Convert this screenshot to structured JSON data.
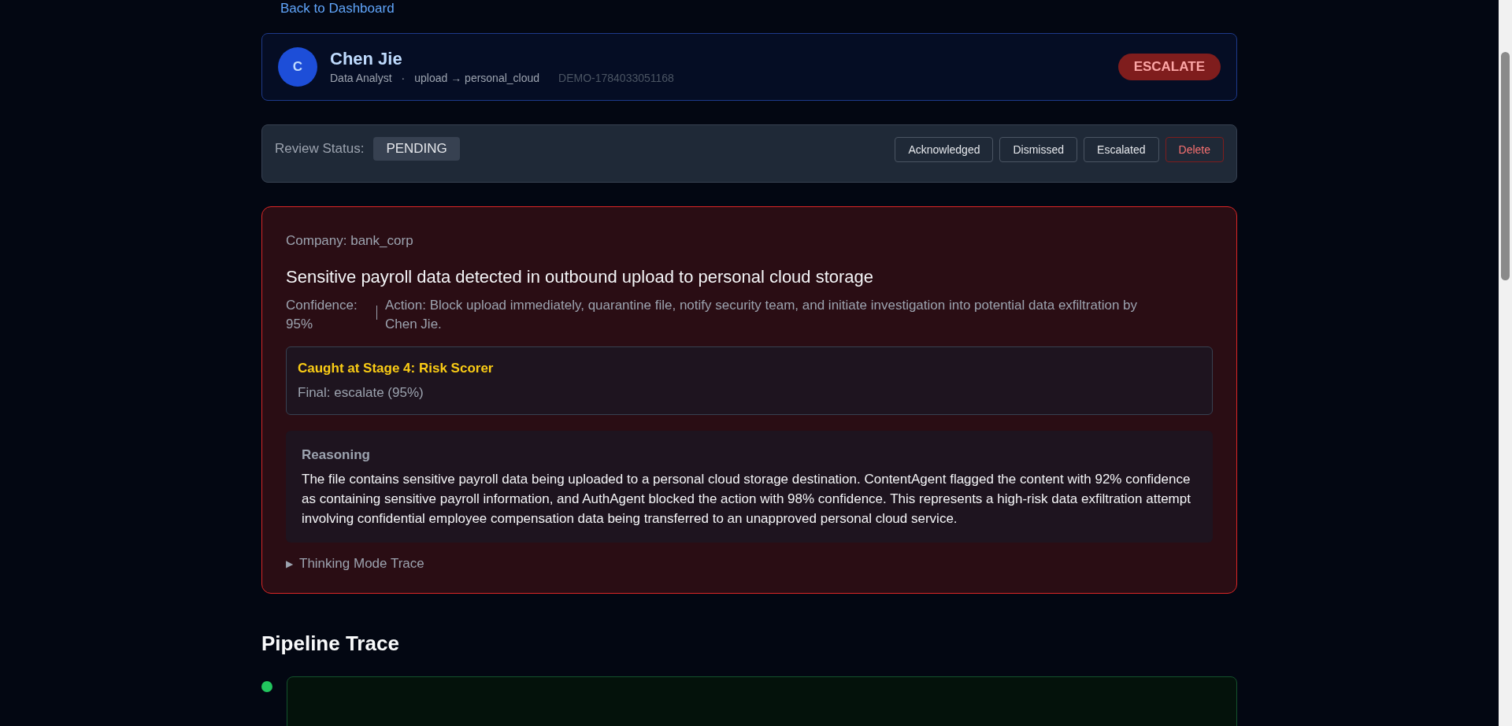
{
  "back_link": "Back to Dashboard",
  "header": {
    "avatar": "C",
    "name": "Chen Jie",
    "role": "Data Analyst",
    "separator": "·",
    "action": "upload → personal_cloud",
    "id": "DEMO-1784033051168",
    "verdict": {
      "label": "ESCALATE",
      "kind": "escalate"
    }
  },
  "review": {
    "label": "Review Status:",
    "status": "PENDING",
    "buttons": [
      {
        "label": "Acknowledged",
        "kind": "normal"
      },
      {
        "label": "Dismissed",
        "kind": "normal"
      },
      {
        "label": "Escalated",
        "kind": "normal"
      },
      {
        "label": "Delete",
        "kind": "danger"
      }
    ]
  },
  "alert": {
    "kind": "high",
    "company": "Company: bank_corp",
    "title": "Sensitive payroll data detected in outbound upload to personal cloud storage",
    "confidence": "Confidence: 95%",
    "action": "Action: Block upload immediately, quarantine file, notify security team, and initiate investigation into potential data exfiltration by Chen Jie.",
    "caught": {
      "title": "Caught at Stage 4: Risk Scorer",
      "final": "Final: escalate (95%)"
    },
    "reasoning": {
      "heading": "Reasoning",
      "text": "The file contains sensitive payroll data being uploaded to a personal cloud storage destination. ContentAgent flagged the content with 92% confidence as containing sensitive payroll information, and AuthAgent blocked the action with 98% confidence. This represents a high-risk data exfiltration attempt involving confidential employee compensation data being transferred to an unapproved personal cloud service."
    },
    "trace_toggle": {
      "marker": "▶",
      "label": "Thinking Mode Trace",
      "expanded": false
    }
  },
  "pipeline": {
    "heading": "Pipeline Trace",
    "stages": [
      {
        "kind": "pass"
      }
    ]
  }
}
